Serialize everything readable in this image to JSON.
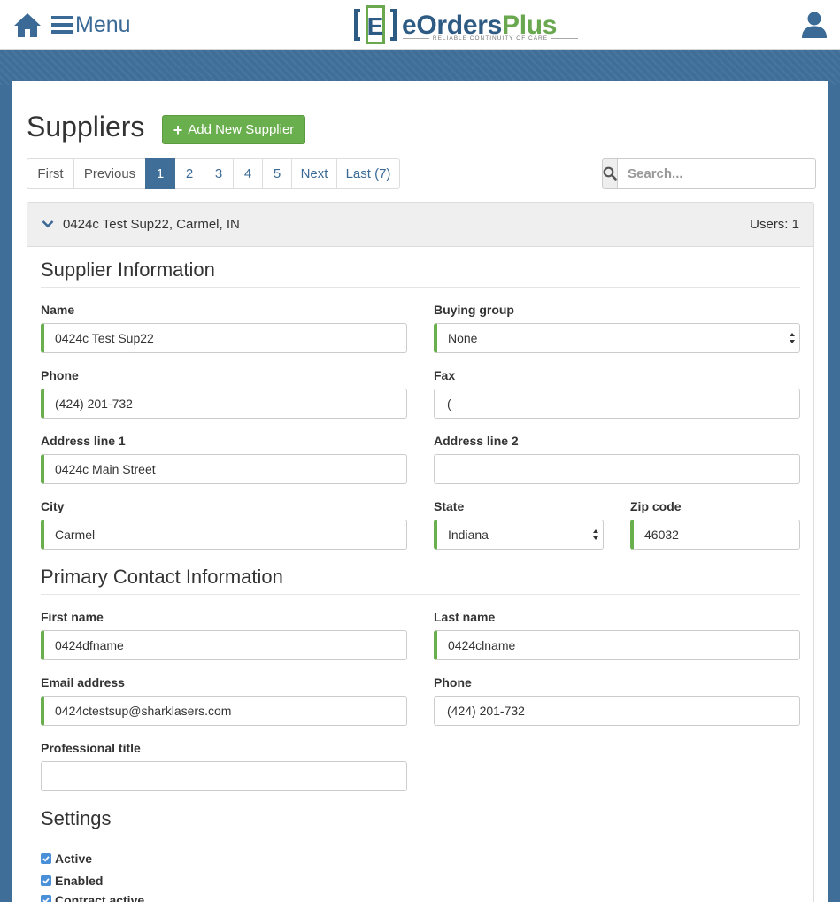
{
  "nav": {
    "menu_label": "Menu"
  },
  "logo": {
    "letter": "E",
    "word_e": "e",
    "word_orders": "Orders",
    "word_plus": "Plus",
    "tagline": "RELIABLE CONTINUITY OF CARE"
  },
  "page": {
    "title": "Suppliers",
    "add_button": "Add New Supplier"
  },
  "pagination": {
    "first": "First",
    "previous": "Previous",
    "pages": [
      "1",
      "2",
      "3",
      "4",
      "5"
    ],
    "active_page": "1",
    "next": "Next",
    "last": "Last (7)"
  },
  "search": {
    "placeholder": "Search..."
  },
  "supplier": {
    "header": "0424c Test Sup22, Carmel, IN",
    "users": "Users: 1"
  },
  "sections": {
    "supplier_info": "Supplier Information",
    "primary_contact": "Primary Contact Information",
    "settings": "Settings"
  },
  "form": {
    "name": {
      "label": "Name",
      "value": "0424c Test Sup22"
    },
    "buying_group": {
      "label": "Buying group",
      "value": "None"
    },
    "phone": {
      "label": "Phone",
      "value": "(424) 201-732"
    },
    "fax": {
      "label": "Fax",
      "value": "("
    },
    "address1": {
      "label": "Address line 1",
      "value": "0424c Main Street"
    },
    "address2": {
      "label": "Address line 2",
      "value": ""
    },
    "city": {
      "label": "City",
      "value": "Carmel"
    },
    "state": {
      "label": "State",
      "value": "Indiana"
    },
    "zip": {
      "label": "Zip code",
      "value": "46032"
    },
    "first_name": {
      "label": "First name",
      "value": "0424dfname"
    },
    "last_name": {
      "label": "Last name",
      "value": "0424clname"
    },
    "email": {
      "label": "Email address",
      "value": "0424ctestsup@sharklasers.com"
    },
    "contact_phone": {
      "label": "Phone",
      "value": "(424) 201-732"
    },
    "title": {
      "label": "Professional title",
      "value": ""
    }
  },
  "settings": [
    {
      "label": "Active",
      "checked": true
    },
    {
      "label": "Enabled",
      "checked": true
    },
    {
      "label": "Contract active",
      "checked": true
    }
  ],
  "colors": {
    "brand_blue": "#3f6f99",
    "accent_green": "#6aaf4d",
    "checkbox_blue": "#4a90d9"
  }
}
